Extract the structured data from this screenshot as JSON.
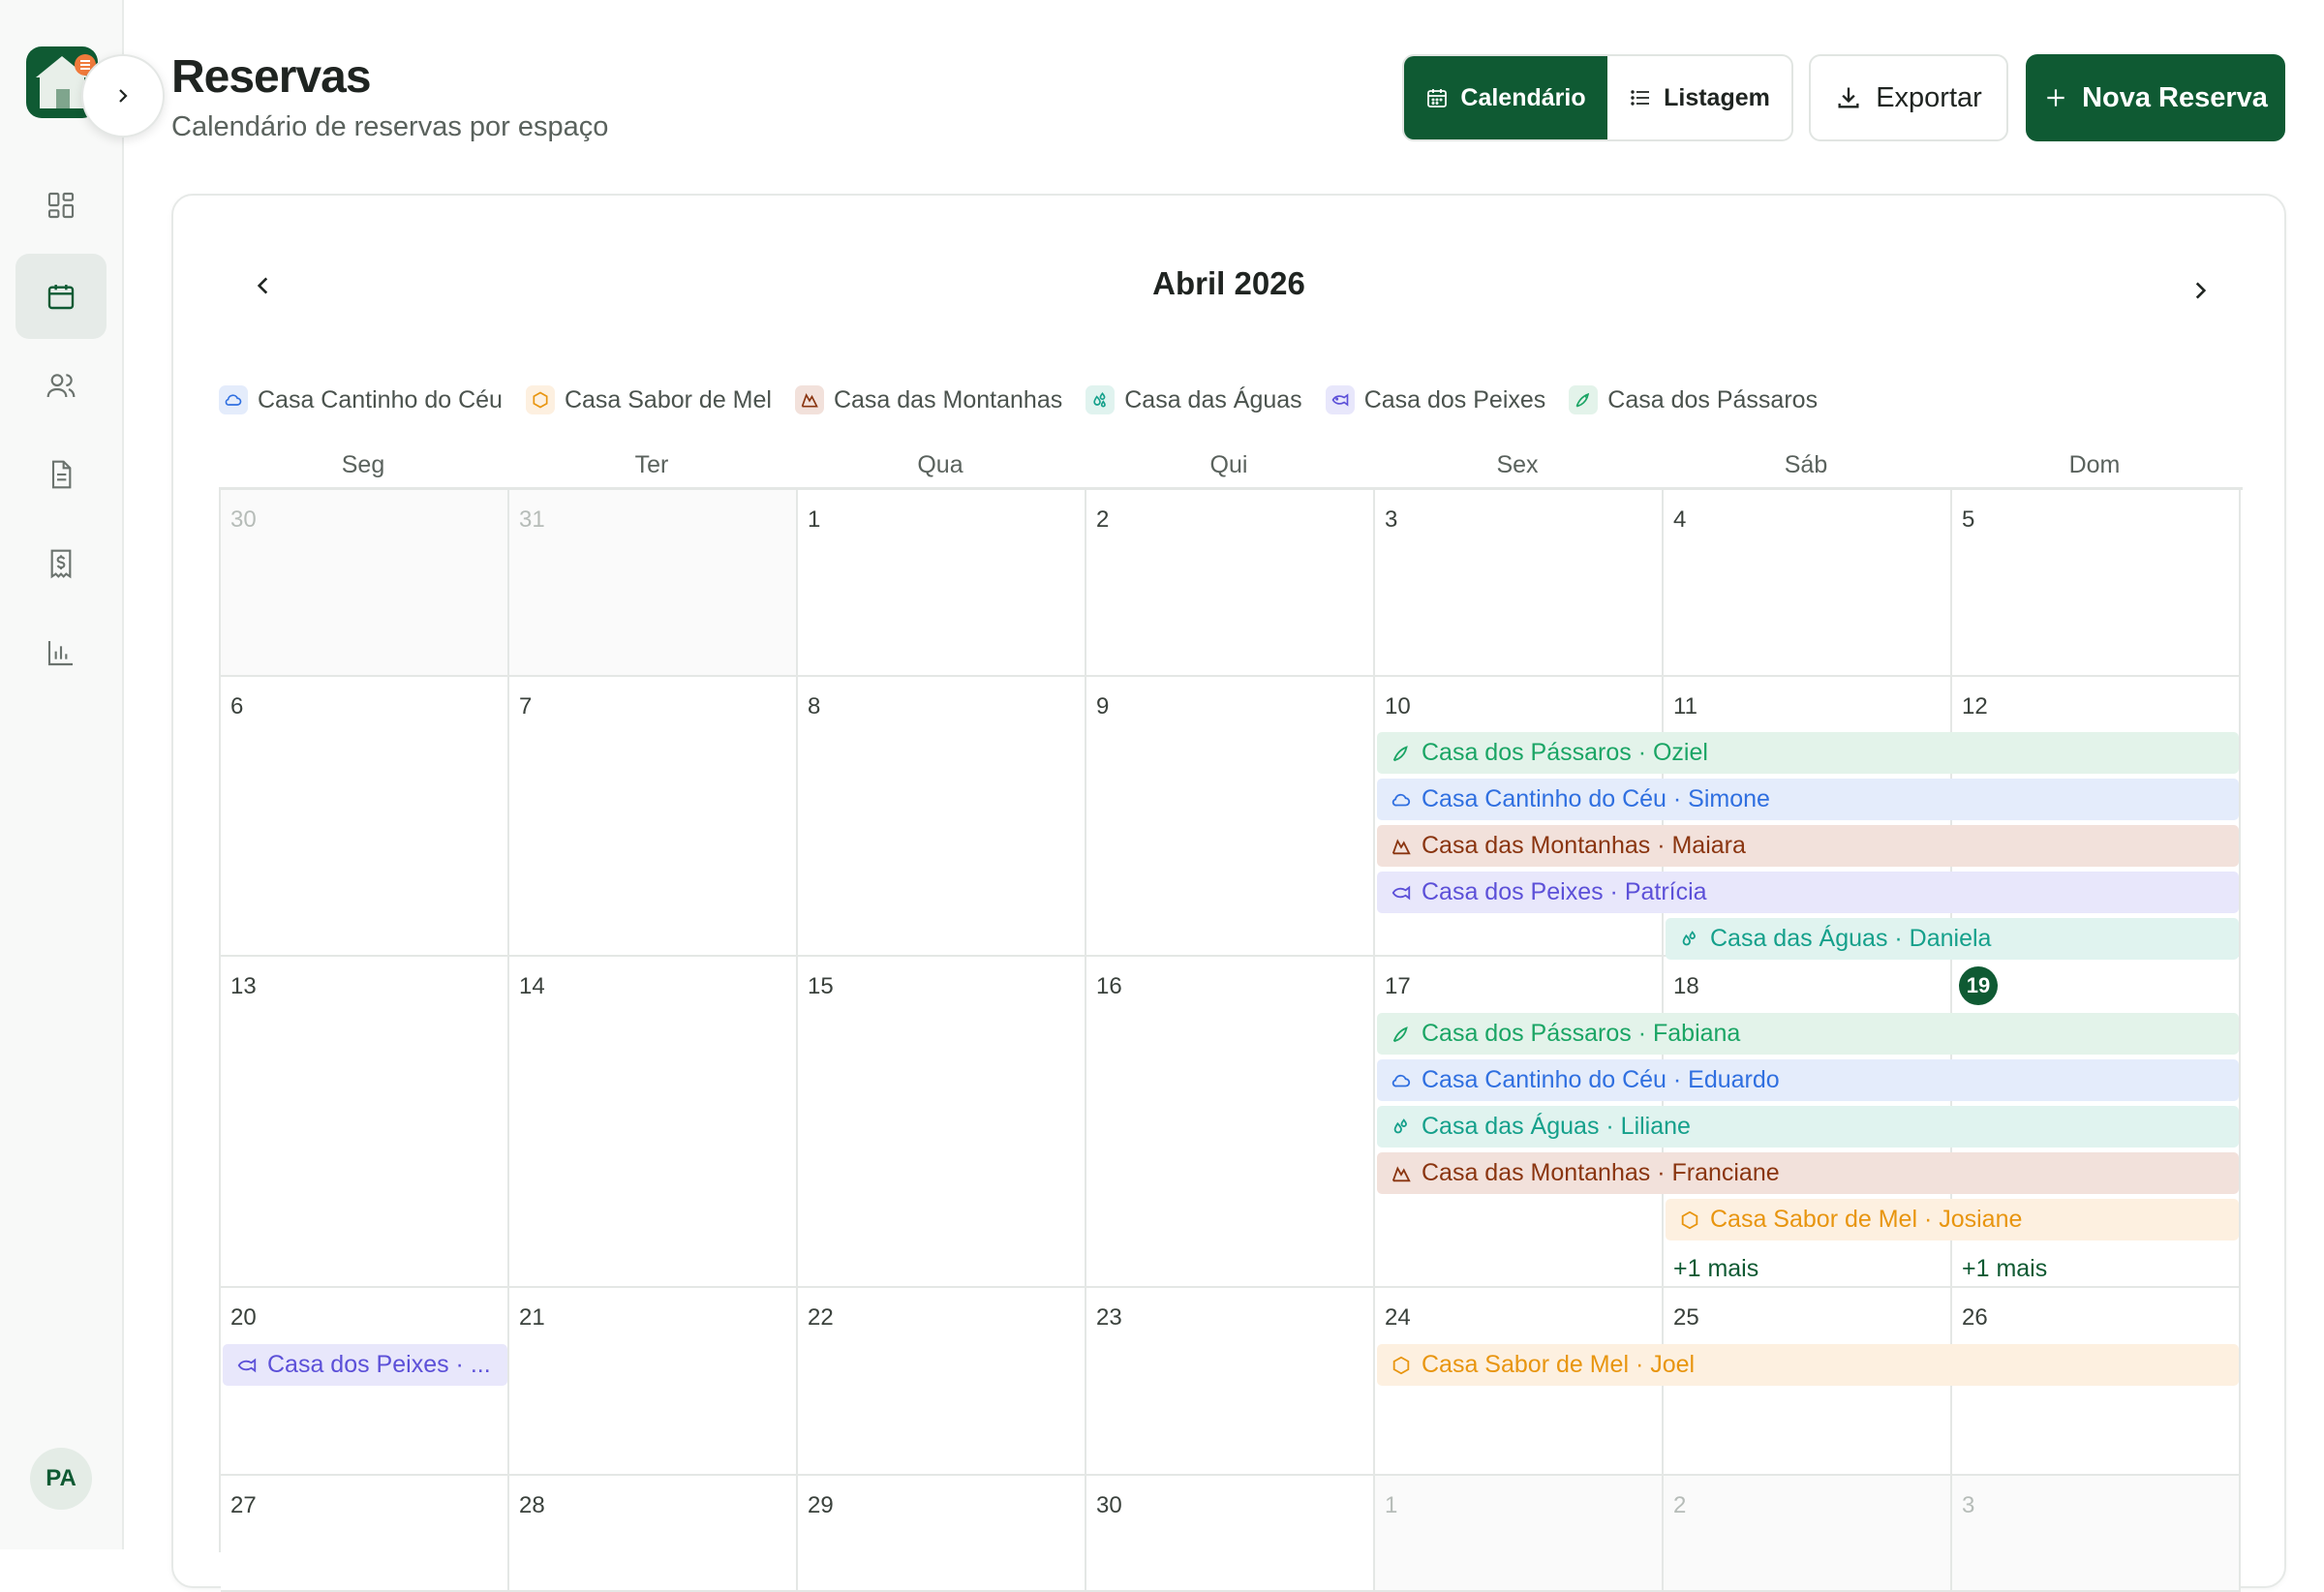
{
  "sidebar": {
    "collapsed_toggle": "expand-sidebar",
    "items": [
      {
        "name": "dashboard",
        "icon": "grid-icon"
      },
      {
        "name": "calendar",
        "icon": "calendar-icon",
        "active": true
      },
      {
        "name": "guests",
        "icon": "users-icon"
      },
      {
        "name": "documents",
        "icon": "document-icon"
      },
      {
        "name": "finance",
        "icon": "dollar-receipt-icon"
      },
      {
        "name": "reports",
        "icon": "bar-chart-icon"
      }
    ],
    "avatar_initials": "PA"
  },
  "header": {
    "title": "Reservas",
    "subtitle": "Calendário de reservas por espaço",
    "view_toggle": {
      "calendar_label": "Calendário",
      "list_label": "Listagem",
      "selected": "Calendário"
    },
    "export_label": "Exportar",
    "new_label": "Nova Reserva"
  },
  "calendar": {
    "month_title": "Abril 2026",
    "weekdays": [
      "Seg",
      "Ter",
      "Qua",
      "Qui",
      "Sex",
      "Sáb",
      "Dom"
    ],
    "legend": [
      {
        "label": "Casa Cantinho do Céu",
        "icon": "cloud-icon",
        "color": "#2f6fe0",
        "bg": "#e4ecfb"
      },
      {
        "label": "Casa Sabor de Mel",
        "icon": "hexagon-icon",
        "color": "#e8950f",
        "bg": "#fdf0e0"
      },
      {
        "label": "Casa das Montanhas",
        "icon": "mountain-icon",
        "color": "#8a3510",
        "bg": "#f2e1db"
      },
      {
        "label": "Casa das Águas",
        "icon": "droplets-icon",
        "color": "#15a08b",
        "bg": "#e0f3ef"
      },
      {
        "label": "Casa dos Peixes",
        "icon": "fish-icon",
        "color": "#5c50d8",
        "bg": "#e8e7fb"
      },
      {
        "label": "Casa dos Pássaros",
        "icon": "bird-icon",
        "color": "#1ba565",
        "bg": "#e3f3ea"
      }
    ],
    "weeks": [
      [
        "30",
        "31",
        "1",
        "2",
        "3",
        "4",
        "5"
      ],
      [
        "6",
        "7",
        "8",
        "9",
        "10",
        "11",
        "12"
      ],
      [
        "13",
        "14",
        "15",
        "16",
        "17",
        "18",
        "19"
      ],
      [
        "20",
        "21",
        "22",
        "23",
        "24",
        "25",
        "26"
      ],
      [
        "27",
        "28",
        "29",
        "30",
        "1",
        "2",
        "3"
      ]
    ],
    "today": "19",
    "events": [
      {
        "label": "Casa dos Pássaros · Oziel"
      },
      {
        "label": "Casa Cantinho do Céu · Simone"
      },
      {
        "label": "Casa das Montanhas · Maiara"
      },
      {
        "label": "Casa dos Peixes · Patrícia"
      },
      {
        "label": "Casa das Águas · Daniela"
      },
      {
        "label": "Casa dos Pássaros · Fabiana"
      },
      {
        "label": "Casa Cantinho do Céu · Eduardo"
      },
      {
        "label": "Casa das Águas · Liliane"
      },
      {
        "label": "Casa das Montanhas · Franciane"
      },
      {
        "label": "Casa Sabor de Mel · Josiane"
      },
      {
        "label": "Casa dos Peixes · ..."
      },
      {
        "label": "Casa Sabor de Mel · Joel"
      }
    ],
    "more_label": "+1 mais"
  }
}
